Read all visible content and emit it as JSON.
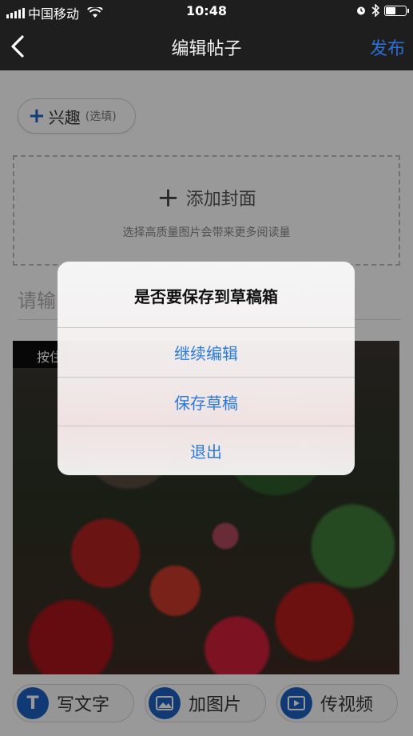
{
  "status_bar": {
    "carrier": "中国移动",
    "time": "10:48"
  },
  "nav": {
    "back_icon": "chevron-left-icon",
    "title": "编辑帖子",
    "publish_label": "发布",
    "publish_color": "#2d6fd6"
  },
  "editor": {
    "interest_button": {
      "icon": "plus-icon",
      "label": "兴趣",
      "hint": "(选填)"
    },
    "cover": {
      "icon": "plus-icon",
      "label": "添加封面",
      "hint": "选择高质量图片会带来更多阅读量"
    },
    "title_placeholder": "请输",
    "photo_label": "按住"
  },
  "toolbar": {
    "items": [
      {
        "icon": "text-icon",
        "icon_glyph": "T",
        "label": "写文字"
      },
      {
        "icon": "image-icon",
        "label": "加图片"
      },
      {
        "icon": "video-icon",
        "label": "传视频"
      }
    ]
  },
  "dialog": {
    "title": "是否要保存到草稿箱",
    "buttons": [
      "继续编辑",
      "保存草稿",
      "退出"
    ],
    "button_color": "#2a7bd9"
  }
}
